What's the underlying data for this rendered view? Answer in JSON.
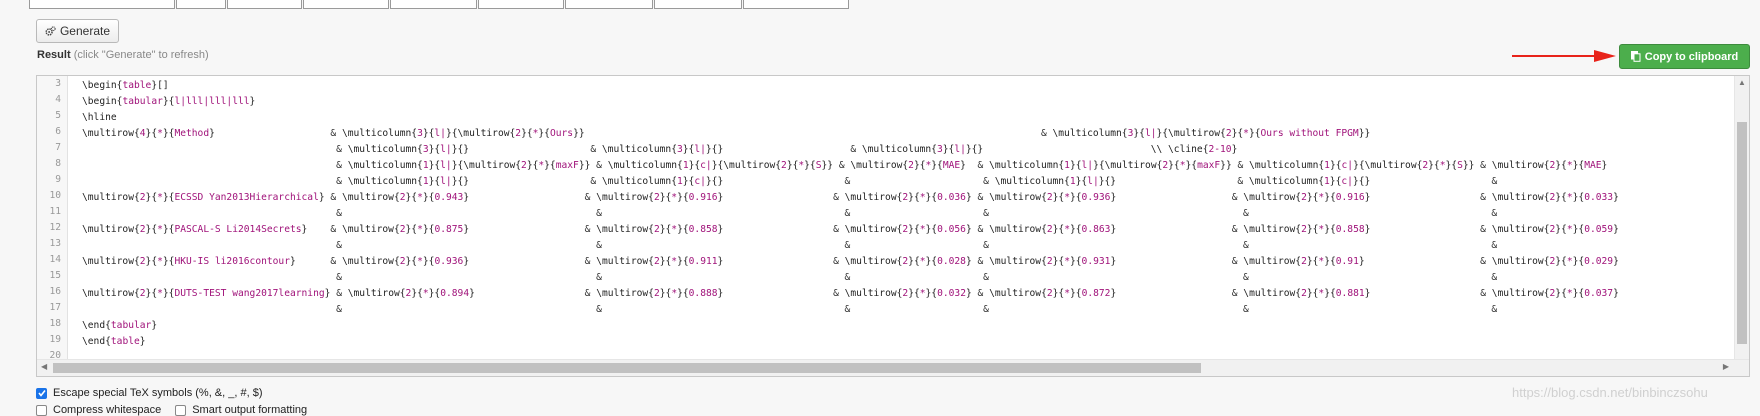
{
  "toolbar": {
    "generate_label": "Generate"
  },
  "result": {
    "label": "Result",
    "hint": "(click \"Generate\" to refresh)"
  },
  "copy": {
    "label": "Copy to clipboard"
  },
  "editor": {
    "line_numbers": [
      "3",
      "4",
      "5",
      "6",
      "7",
      "8",
      "9",
      "10",
      "11",
      "12",
      "13",
      "14",
      "15",
      "16",
      "17",
      "18",
      "19",
      "20"
    ],
    "lines": [
      "\\begin{table}[]",
      "\\begin{tabular}{l|lll|lll|lll}",
      "\\hline",
      "\\multirow{4}{*}{Method}                    & \\multicolumn{3}{l|}{\\multirow{2}{*}{Ours}}                                                                               & \\multicolumn{3}{l|}{\\multirow{2}{*}{Ours without FPGM}}",
      "                                            & \\multicolumn{3}{l|}{}                     & \\multicolumn{3}{l|}{}                      & \\multicolumn{3}{l|}{}                             \\\\ \\cline{2-10}",
      "                                            & \\multicolumn{1}{l|}{\\multirow{2}{*}{maxF}} & \\multicolumn{1}{c|}{\\multirow{2}{*}{S}} & \\multirow{2}{*}{MAE}  & \\multicolumn{1}{l|}{\\multirow{2}{*}{maxF}} & \\multicolumn{1}{c|}{\\multirow{2}{*}{S}} & \\multirow{2}{*}{MAE}",
      "                                            & \\multicolumn{1}{l|}{}                     & \\multicolumn{1}{c|}{}                     &                       & \\multicolumn{1}{l|}{}                     & \\multicolumn{1}{c|}{}                     &",
      "\\multirow{2}{*}{ECSSD Yan2013Hierarchical} & \\multirow{2}{*}{0.943}                    & \\multirow{2}{*}{0.916}                   & \\multirow{2}{*}{0.036} & \\multirow{2}{*}{0.936}                    & \\multirow{2}{*}{0.916}                   & \\multirow{2}{*}{0.033}",
      "                                            &                                            &                                          &                       &                                            &                                          &",
      "\\multirow{2}{*}{PASCAL-S Li2014Secrets}    & \\multirow{2}{*}{0.875}                    & \\multirow{2}{*}{0.858}                   & \\multirow{2}{*}{0.056} & \\multirow{2}{*}{0.863}                    & \\multirow{2}{*}{0.858}                   & \\multirow{2}{*}{0.059}",
      "                                            &                                            &                                          &                       &                                            &                                          &",
      "\\multirow{2}{*}{HKU-IS li2016contour}      & \\multirow{2}{*}{0.936}                    & \\multirow{2}{*}{0.911}                   & \\multirow{2}{*}{0.028} & \\multirow{2}{*}{0.931}                    & \\multirow{2}{*}{0.91}                    & \\multirow{2}{*}{0.029}",
      "                                            &                                            &                                          &                       &                                            &                                          &",
      "\\multirow{2}{*}{DUTS-TEST wang2017learning} & \\multirow{2}{*}{0.894}                   & \\multirow{2}{*}{0.888}                   & \\multirow{2}{*}{0.032} & \\multirow{2}{*}{0.872}                    & \\multirow{2}{*}{0.881}                   & \\multirow{2}{*}{0.037}",
      "                                            &                                            &                                          &                       &                                            &                                          &",
      "\\end{tabular}",
      "\\end{table}",
      ""
    ]
  },
  "options": {
    "escape_label": "Escape special TeX symbols (%, &, _, #, $)",
    "escape_checked": true,
    "compress_label": "Compress whitespace",
    "compress_checked": false,
    "smart_label": "Smart output formatting",
    "smart_checked": false
  },
  "watermark": "https://blog.csdn.net/binbinczsohu",
  "colors": {
    "accent_green": "#4cae4c",
    "arrow_red": "#e8231a"
  },
  "icons": {
    "generate": "gears-icon",
    "copy": "copy-icon"
  }
}
